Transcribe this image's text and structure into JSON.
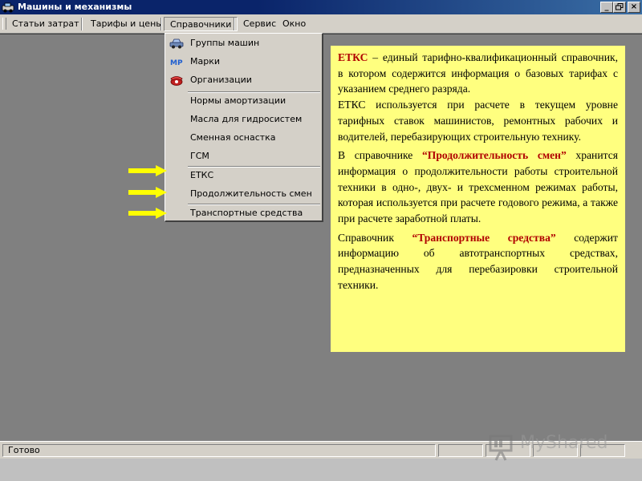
{
  "window": {
    "title": "Машины и механизмы",
    "controls": [
      "minimize",
      "restore",
      "close"
    ]
  },
  "menubar": {
    "items": [
      {
        "label": "Статьи затрат"
      },
      {
        "label": "Тарифы и цены"
      },
      {
        "label": "Справочники",
        "open": true
      },
      {
        "label": "Сервис"
      },
      {
        "label": "Окно"
      }
    ]
  },
  "dropdown": {
    "group1": [
      {
        "label": "Группы машин",
        "icon": "car-icon"
      },
      {
        "label": "Марки",
        "icon": "mp-icon"
      },
      {
        "label": "Организации",
        "icon": "telephone-icon"
      }
    ],
    "group2": [
      {
        "label": "Нормы амортизации"
      },
      {
        "label": "Масла для гидросистем"
      },
      {
        "label": "Сменная оснастка"
      },
      {
        "label": "ГСМ"
      }
    ],
    "group3": [
      {
        "label": "ЕТКС"
      },
      {
        "label": "Продолжительность смен"
      }
    ],
    "group4": [
      {
        "label": "Транспортные средства"
      }
    ]
  },
  "note": {
    "p1_term": "ЕТКС",
    "p1_text": " – единый тарифно-квалификационный справочник, в котором содержится информация о базовых тарифах с указанием среднего разряда.",
    "p2_text": "ЕТКС используется при расчете в текущем уровне тарифных ставок машинистов, ремонтных рабочих и водителей, перебазирующих строительную технику.",
    "p3_pre": "В справочнике ",
    "p3_term": "“Продолжительность смен”",
    "p3_text": " хранится информация о продолжительности работы строительной техники в одно-, двух- и трехсменном режимах работы, которая используется при расчете годового режима, а также при расчете заработной платы.",
    "p4_pre": "Справочник ",
    "p4_term": "“Транспортные средства”",
    "p4_text": " содержит информацию об автотранспортных средствах, предназначенных для перебазировки строительной техники."
  },
  "statusbar": {
    "text": "Готово"
  },
  "watermark": {
    "text": "MyShared"
  },
  "colors": {
    "title_bar": "#0a246a",
    "client_bg": "#808080",
    "note_bg": "#ffff7f",
    "arrow": "#ffff00",
    "highlight_text": "#b00000"
  }
}
